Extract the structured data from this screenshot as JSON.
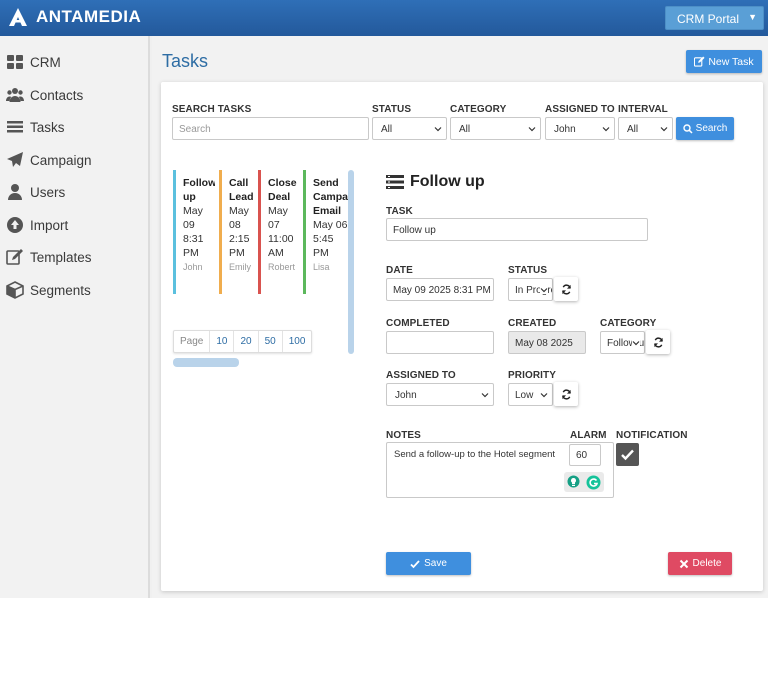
{
  "header": {
    "brand": "ANTAMEDIA",
    "portal": "CRM Portal"
  },
  "sidebar": {
    "items": [
      {
        "label": "CRM",
        "icon": "grid-icon"
      },
      {
        "label": "Contacts",
        "icon": "users-icon"
      },
      {
        "label": "Tasks",
        "icon": "list-icon"
      },
      {
        "label": "Campaign",
        "icon": "paper-plane-icon"
      },
      {
        "label": "Users",
        "icon": "user-icon"
      },
      {
        "label": "Import",
        "icon": "import-icon"
      },
      {
        "label": "Templates",
        "icon": "edit-icon"
      },
      {
        "label": "Segments",
        "icon": "cube-icon"
      }
    ]
  },
  "page": {
    "title": "Tasks",
    "new_task_label": "New Task"
  },
  "filters": {
    "search_label": "SEARCH TASKS",
    "search_placeholder": "Search",
    "status_label": "STATUS",
    "status_value": "All",
    "category_label": "CATEGORY",
    "category_value": "All",
    "assigned_label": "ASSIGNED TO",
    "assigned_value": "John",
    "interval_label": "INTERVAL",
    "interval_value": "All",
    "search_button": "Search"
  },
  "cards": [
    {
      "title": "Follow up",
      "date": "May 09 8:31 PM",
      "user": "John",
      "color": "#5bc0de"
    },
    {
      "title": "Call Lead",
      "date": "May 08 2:15 PM",
      "user": "Emily",
      "color": "#f0ad4e"
    },
    {
      "title": "Close Deal",
      "date": "May 07 11:00 AM",
      "user": "Robert",
      "color": "#d9534f"
    },
    {
      "title": "Send Campaign Email",
      "date": "May 06 5:45 PM",
      "user": "Lisa",
      "color": "#5cb85c"
    }
  ],
  "pager": {
    "label": "Page",
    "sizes": [
      "10",
      "20",
      "50",
      "100"
    ]
  },
  "detail": {
    "title": "Follow up",
    "task_label": "TASK",
    "task_value": "Follow up",
    "date_label": "DATE",
    "date_value": "May 09 2025 8:31 PM",
    "status_label": "STATUS",
    "status_value": "In Progress",
    "completed_label": "COMPLETED",
    "completed_value": "",
    "created_label": "CREATED",
    "created_value": "May 08 2025",
    "category_label": "CATEGORY",
    "category_value": "Follow up",
    "assigned_label": "ASSIGNED TO",
    "assigned_value": "John",
    "priority_label": "PRIORITY",
    "priority_value": "Low",
    "notes_label": "NOTES",
    "notes_value": "Send a follow-up to the Hotel segment",
    "alarm_label": "ALARM",
    "alarm_value": "60",
    "notification_label": "NOTIFICATION",
    "notification_checked": true,
    "save_label": "Save",
    "delete_label": "Delete"
  },
  "colors": {
    "header": "#2a65aa",
    "primary": "#3f8fde",
    "danger": "#df4a63",
    "title": "#2e6da4"
  }
}
